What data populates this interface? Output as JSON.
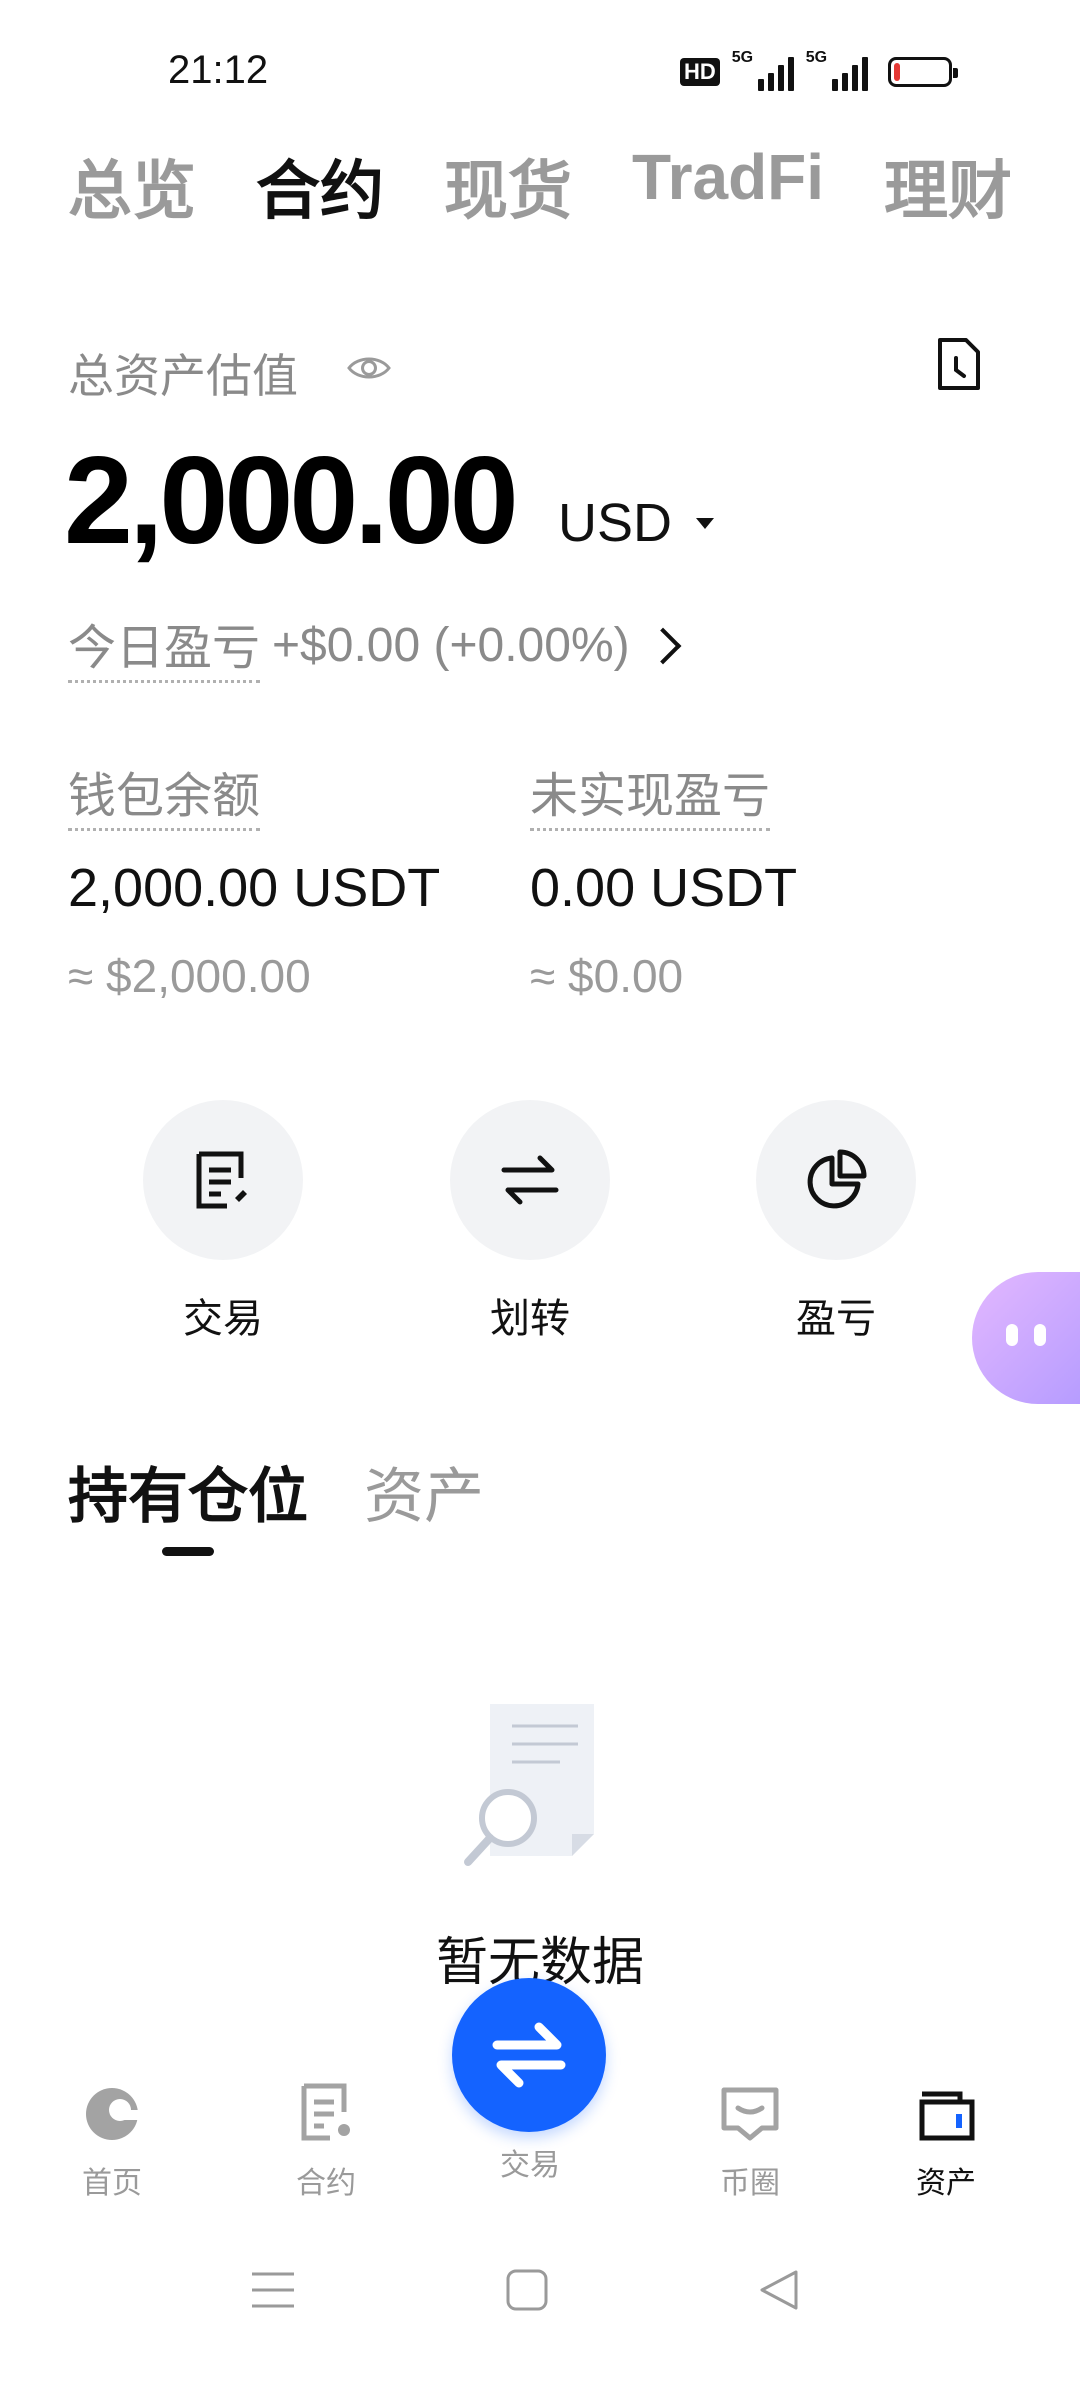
{
  "status_bar": {
    "time": "21:12",
    "hd_badge": "HD",
    "signal1_label": "5G",
    "signal2_label": "5G",
    "battery_level": 0.12,
    "battery_color": "#e53935"
  },
  "top_tabs": [
    {
      "label": "总览",
      "active": false
    },
    {
      "label": "合约",
      "active": true
    },
    {
      "label": "现货",
      "active": false
    },
    {
      "label": "TradFi",
      "active": false
    },
    {
      "label": "理财",
      "active": false
    }
  ],
  "assets": {
    "label": "总资产估值",
    "eye_icon": "eye-icon",
    "history_icon": "history-doc-icon",
    "amount": "2,000.00",
    "currency": "USD"
  },
  "pnl": {
    "label": "今日盈亏",
    "value": "+$0.00 (+0.00%)"
  },
  "balances": {
    "wallet": {
      "label": "钱包余额",
      "value": "2,000.00 USDT",
      "approx": "≈ $2,000.00"
    },
    "unrealized": {
      "label": "未实现盈亏",
      "value": "0.00 USDT",
      "approx": "≈ $0.00"
    }
  },
  "actions": [
    {
      "label": "交易",
      "icon": "trade-doc-icon"
    },
    {
      "label": "划转",
      "icon": "transfer-arrows-icon"
    },
    {
      "label": "盈亏",
      "icon": "pie-chart-icon"
    }
  ],
  "section_tabs": [
    {
      "label": "持有仓位",
      "active": true
    },
    {
      "label": "资产",
      "active": false
    }
  ],
  "empty_state": {
    "text": "暂无数据",
    "icon": "empty-search-document-icon"
  },
  "bottom_nav": [
    {
      "label": "首页",
      "icon": "home-logo-icon",
      "active": false
    },
    {
      "label": "合约",
      "icon": "contract-doc-icon",
      "active": false
    },
    {
      "label": "交易",
      "icon": "swap-arrows-icon",
      "active": false
    },
    {
      "label": "币圈",
      "icon": "chat-bubble-icon",
      "active": false
    },
    {
      "label": "资产",
      "icon": "wallet-icon",
      "active": true
    }
  ],
  "colors": {
    "accent": "#1463ff",
    "muted": "#9a9a9a",
    "assistant_gradient_start": "#e3b8ff",
    "assistant_gradient_end": "#b69cff"
  }
}
